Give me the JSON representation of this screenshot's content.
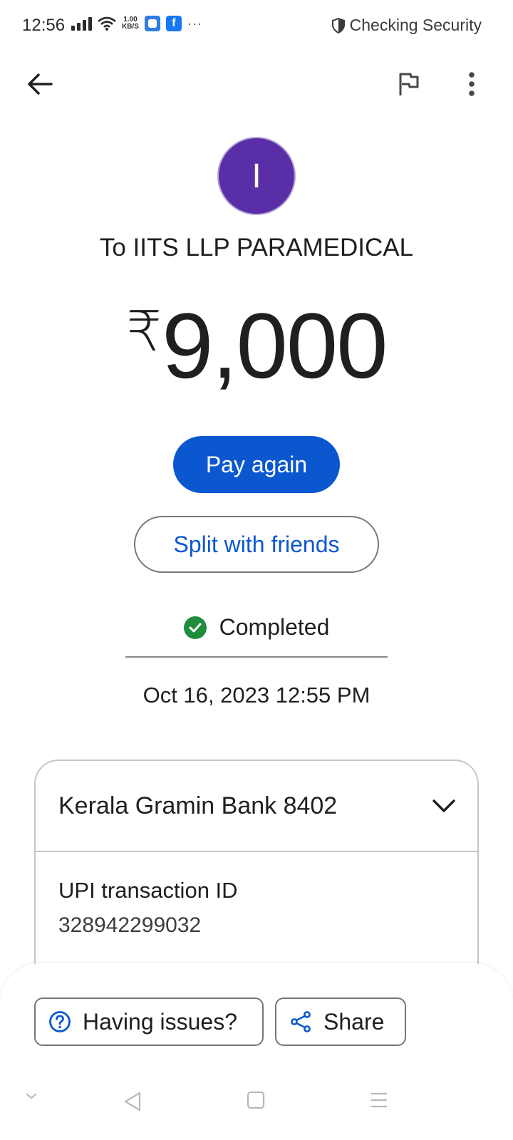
{
  "status_bar": {
    "time": "12:56",
    "speed_top": "1.00",
    "speed_bottom": "KB/S",
    "more": "···",
    "security_text": "Checking Security"
  },
  "header": {
    "avatar_initial": "I",
    "payee": "To IITS LLP PARAMEDICAL",
    "currency_symbol": "₹",
    "amount": "9,000"
  },
  "actions": {
    "pay_again": "Pay again",
    "split": "Split with friends"
  },
  "transaction": {
    "status": "Completed",
    "datetime": "Oct 16, 2023 12:55 PM",
    "bank": "Kerala Gramin Bank 8402",
    "upi_label": "UPI transaction ID",
    "upi_id": "328942299032"
  },
  "bottom": {
    "issues": "Having issues?",
    "share": "Share"
  },
  "colors": {
    "accent": "#0b57d0",
    "avatar": "#5a2ea6",
    "success": "#1e8e3e"
  },
  "icons": [
    "back-arrow-icon",
    "flag-icon",
    "more-vert-icon",
    "check-circle-icon",
    "chevron-down-icon",
    "help-circle-icon",
    "share-icon"
  ]
}
